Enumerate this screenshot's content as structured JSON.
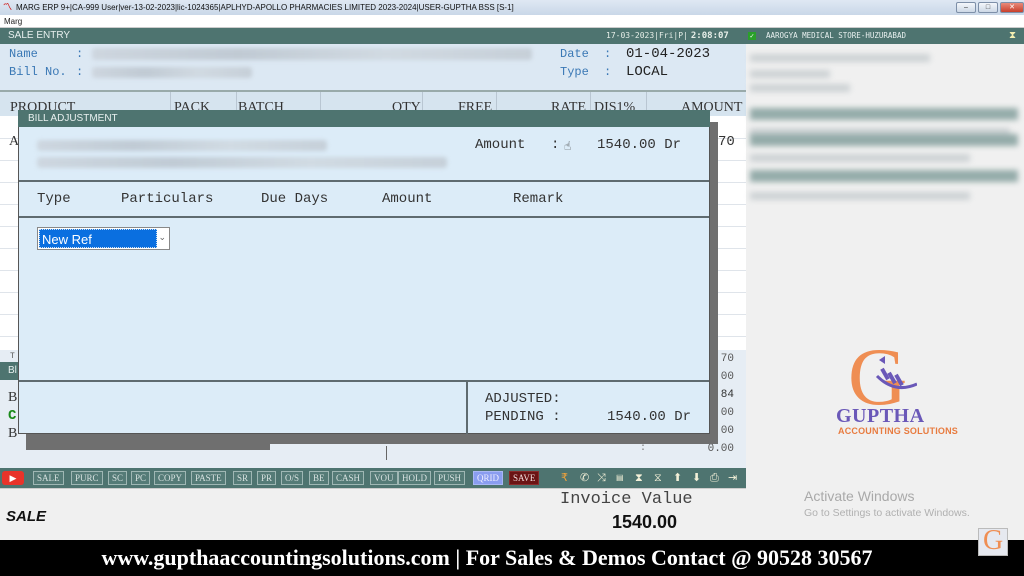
{
  "window": {
    "title": "MARG ERP 9+|CA-999 User|ver-13-02-2023|lic-1024365|APLHYD-APOLLO PHARMACIES LIMITED 2023-2024|USER-GUPTHA BSS [S-1]",
    "menu_label": "Marg",
    "minimize": "–",
    "restore": "□",
    "close": "✕"
  },
  "sale_entry": {
    "title": "SALE ENTRY",
    "clock_date": "17-03-2023|Fri|P|",
    "clock_time": "2:08:07",
    "name_label": "Name",
    "bill_no_label": "Bill No.",
    "colon": ":",
    "date_label": "Date",
    "date_value": "01-04-2023",
    "type_label": "Type",
    "type_value": "LOCAL",
    "columns": [
      "PRODUCT",
      "PACK",
      "BATCH",
      "QTY",
      "FREE",
      "RATE",
      "DIS1%",
      "AMOUNT"
    ],
    "first_row_product_initial": "A",
    "first_row_amount_partial": "70",
    "totals_partial": [
      "70",
      "00",
      "84",
      "00",
      "00",
      "0.00"
    ],
    "side_letters": [
      "B",
      "C",
      "B"
    ],
    "bill_strip": "Bl",
    "row_t_label": "T"
  },
  "toolbar": {
    "buttons": [
      "SALE",
      "PURC",
      "SC",
      "PC",
      "COPY",
      "PASTE",
      "SR",
      "PR",
      "O/S",
      "BE",
      "CASH",
      "VOU",
      "HOLD",
      "PUSH",
      "QRID",
      "SAVE"
    ],
    "icons": [
      "rupee-icon",
      "phone-icon",
      "shuffle-icon",
      "chat-icon",
      "hourglass-top-icon",
      "hourglass-bottom-icon",
      "arrow-up-icon",
      "arrow-down-icon",
      "printer-icon",
      "exit-icon"
    ]
  },
  "footer": {
    "mode": "SALE",
    "invoice_label": "Invoice Value",
    "invoice_value": "1540.00"
  },
  "right_panel": {
    "title": "AAROGYA MEDICAL STORE-HUZURABAD"
  },
  "dialog": {
    "title": "BILL ADJUSTMENT",
    "amount_label": "Amount",
    "amount_colon": ":",
    "amount_value": "1540.00 Dr",
    "columns": [
      "Type",
      "Particulars",
      "Due Days",
      "Amount",
      "Remark"
    ],
    "type_selected": "New Ref",
    "adjusted_label": "ADJUSTED:",
    "adjusted_value": "",
    "pending_label": "PENDING :",
    "pending_value": "1540.00 Dr"
  },
  "branding": {
    "logo_letter": "G",
    "logo_name": "GUPTHA",
    "logo_tagline": "ACCOUNTING SOLUTIONS",
    "activate_title": "Activate Windows",
    "activate_sub": "Go to Settings to activate Windows.",
    "banner": "www.gupthaaccountingsolutions.com | For Sales & Demos Contact @ 90528 30567"
  },
  "colors": {
    "panel_green": "#4e7470",
    "selection_blue": "#0a6fe0",
    "logo_orange": "#ef8e53",
    "logo_purple": "#6a58b8"
  }
}
